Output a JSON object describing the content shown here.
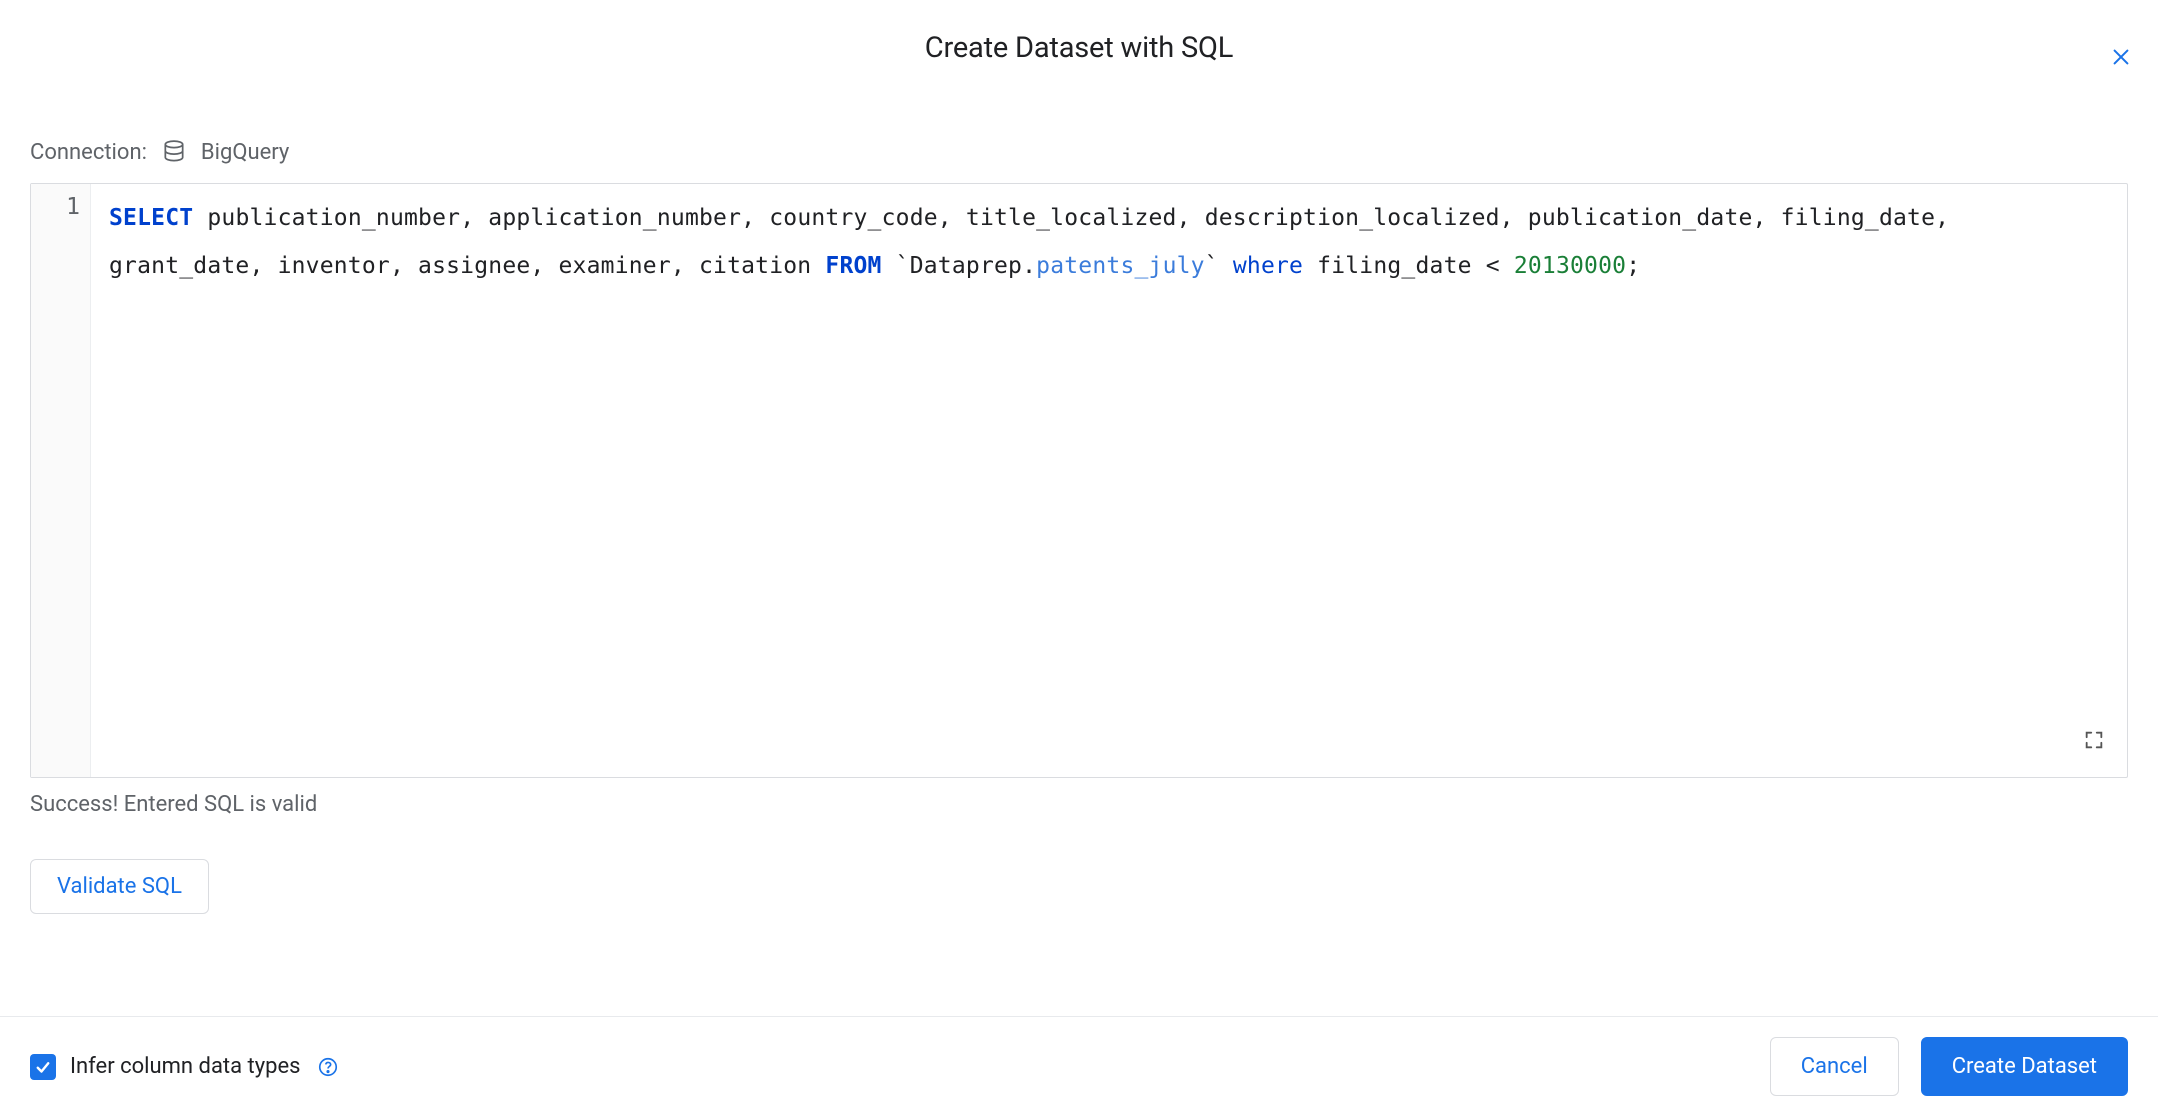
{
  "header": {
    "title": "Create Dataset with SQL"
  },
  "connection": {
    "label": "Connection:",
    "name": "BigQuery"
  },
  "editor": {
    "line_numbers": [
      "1"
    ],
    "sql": {
      "select_kw": "SELECT",
      "columns": " publication_number, application_number, country_code, title_localized, description_localized, publication_date, filing_date, grant_date, inventor, assignee, examiner, citation ",
      "from_kw": "FROM",
      "table_open": " `Dataprep",
      "table_dot": ".",
      "table_name": "patents_july",
      "table_close": "` ",
      "where_kw": "where",
      "predicate_col": " filing_date < ",
      "predicate_val": "20130000",
      "terminator": ";"
    }
  },
  "status_text": "Success! Entered SQL is valid",
  "buttons": {
    "validate": "Validate SQL",
    "cancel": "Cancel",
    "create": "Create Dataset"
  },
  "footer": {
    "infer_label": "Infer column data types",
    "infer_checked": true
  }
}
